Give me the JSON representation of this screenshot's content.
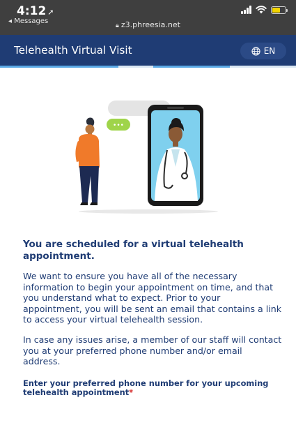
{
  "status_bar": {
    "time": "4:12",
    "back_label": "◂ Messages",
    "url": "z3.phreesia.net",
    "battery_color": "#f2d400"
  },
  "header": {
    "title": "Telehealth Virtual Visit",
    "language": "EN",
    "background": "#1f3c74"
  },
  "illustration": {
    "chat_bubble_text": "•••"
  },
  "content": {
    "headline": "You are scheduled for a virtual telehealth appointment.",
    "paragraphs": [
      "We want to ensure you have all of the necessary information to begin your appointment on time, and that you understand what to expect. Prior to your appointment, you will be sent an email that contains a link to access your virtual telehealth session.",
      "In case any issues arise, a member of our staff will contact you at your preferred phone number and/or email address."
    ],
    "field_label": "Enter your preferred phone number for your upcoming telehealth appointment",
    "required_marker": "*"
  }
}
